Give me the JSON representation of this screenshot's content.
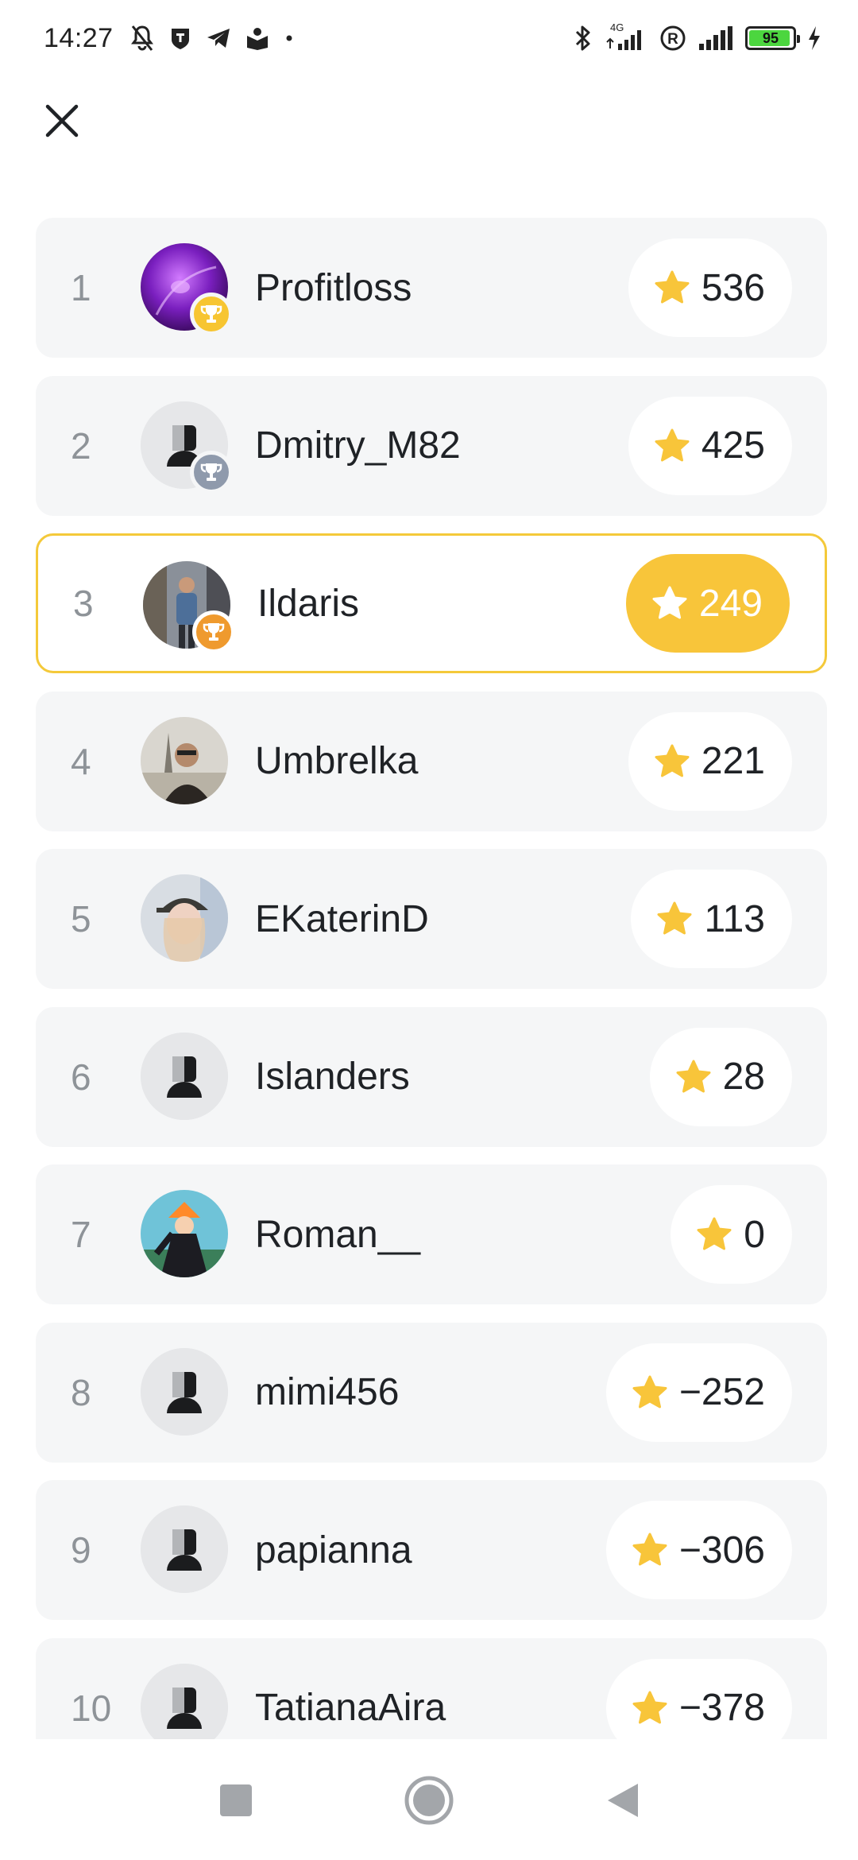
{
  "status_bar": {
    "time": "14:27",
    "network_label": "4G",
    "battery_level": "95",
    "battery_fraction": 0.95
  },
  "colors": {
    "accent": "#f8c53a",
    "highlight_border": "#f4c93a",
    "row_bg": "#f5f6f7",
    "rank_gray": "#8e9398",
    "trophy_gold": "#f7c531",
    "trophy_silver": "#8f9aac",
    "trophy_bronze": "#ef9a2e"
  },
  "header": {
    "close_icon": "close-icon"
  },
  "leaderboard": {
    "rows": [
      {
        "rank": "1",
        "name": "Profitloss",
        "score": "536",
        "trophy": "gold",
        "avatar": "photo-purple",
        "highlight": false
      },
      {
        "rank": "2",
        "name": "Dmitry_M82",
        "score": "425",
        "trophy": "silver",
        "avatar": "placeholder",
        "highlight": false
      },
      {
        "rank": "3",
        "name": "Ildaris",
        "score": "249",
        "trophy": "bronze",
        "avatar": "photo-man-city",
        "highlight": true
      },
      {
        "rank": "4",
        "name": "Umbrelka",
        "score": "221",
        "trophy": "",
        "avatar": "photo-man-paris",
        "highlight": false
      },
      {
        "rank": "5",
        "name": "EKaterinD",
        "score": "113",
        "trophy": "",
        "avatar": "photo-woman-cap",
        "highlight": false
      },
      {
        "rank": "6",
        "name": "Islanders",
        "score": "28",
        "trophy": "",
        "avatar": "placeholder",
        "highlight": false
      },
      {
        "rank": "7",
        "name": "Roman__",
        "score": "0",
        "trophy": "",
        "avatar": "photo-anime",
        "highlight": false
      },
      {
        "rank": "8",
        "name": "mimi456",
        "score": "−252",
        "trophy": "",
        "avatar": "placeholder",
        "highlight": false
      },
      {
        "rank": "9",
        "name": "papianna",
        "score": "−306",
        "trophy": "",
        "avatar": "placeholder",
        "highlight": false
      },
      {
        "rank": "10",
        "name": "TatianaAira",
        "score": "−378",
        "trophy": "",
        "avatar": "placeholder",
        "highlight": false
      }
    ]
  },
  "nav": {
    "recents_icon": "square-icon",
    "home_icon": "circle-icon",
    "back_icon": "triangle-back-icon"
  }
}
